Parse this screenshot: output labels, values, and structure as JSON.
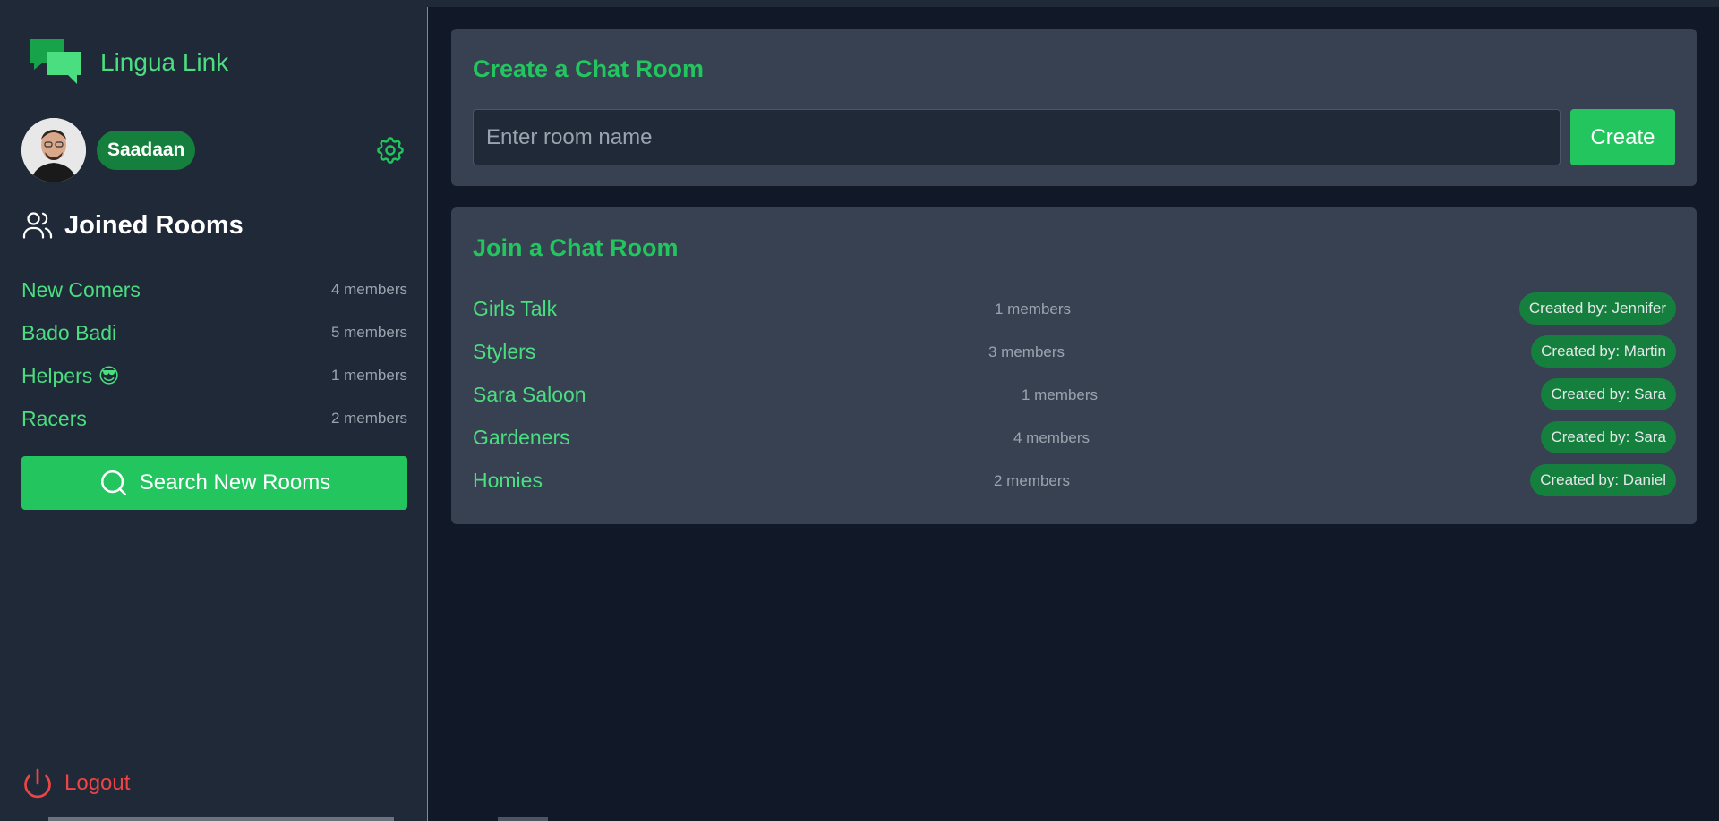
{
  "app": {
    "name": "Lingua Link"
  },
  "user": {
    "name": "Saadaan"
  },
  "sidebar": {
    "joined_title": "Joined Rooms",
    "rooms": [
      {
        "name": "New Comers",
        "members": "4 members"
      },
      {
        "name": "Bado Badi",
        "members": "5 members"
      },
      {
        "name": "Helpers 😎",
        "members": "1 members"
      },
      {
        "name": "Racers",
        "members": "2 members"
      }
    ],
    "search_label": "Search New Rooms",
    "logout_label": "Logout"
  },
  "create": {
    "title": "Create a Chat Room",
    "placeholder": "Enter room name",
    "button_label": "Create"
  },
  "join": {
    "title": "Join a Chat Room",
    "rooms": [
      {
        "name": "Girls Talk",
        "members": "1 members",
        "creator": "Created by: Jennifer"
      },
      {
        "name": "Stylers",
        "members": "3 members",
        "creator": "Created by: Martin"
      },
      {
        "name": "Sara Saloon",
        "members": "1 members",
        "creator": "Created by: Sara"
      },
      {
        "name": "Gardeners",
        "members": "4 members",
        "creator": "Created by: Sara"
      },
      {
        "name": "Homies",
        "members": "2 members",
        "creator": "Created by: Daniel"
      }
    ]
  },
  "colors": {
    "accent": "#22c55e",
    "accent_dark": "#15803d",
    "logout": "#ef4444",
    "background": "#111827",
    "panel": "#1f2937",
    "card": "#374151"
  },
  "icons": {
    "logo": "chat-bubbles-icon",
    "settings": "gear-icon",
    "joined": "users-icon",
    "search": "search-icon",
    "logout": "power-icon"
  }
}
